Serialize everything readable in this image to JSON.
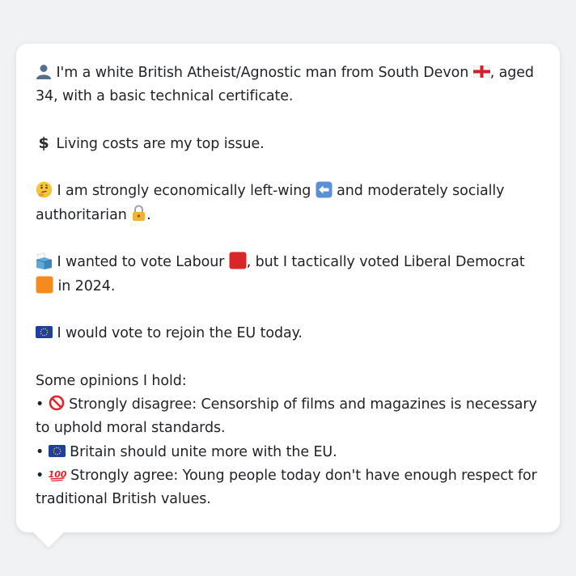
{
  "profile": {
    "intro": {
      "icon": "person-icon",
      "text_a": "I'm a white British Atheist/Agnostic man from South Devon",
      "flag_icon": "england-flag-icon",
      "text_b": ", aged 34, with a basic technical certificate."
    },
    "issue": {
      "icon": "dollar-icon",
      "text": "Living costs are my top issue."
    },
    "ideology": {
      "icon": "thinking-face-icon",
      "text_a": "I am strongly economically left-wing",
      "left_icon": "left-arrow-icon",
      "text_b": "and moderately socially authoritarian",
      "lock_icon": "lock-icon",
      "text_c": "."
    },
    "vote": {
      "icon": "ballot-box-icon",
      "text_a": "I wanted to vote Labour",
      "labour_color": "#d8262a",
      "text_b": ", but I tactically voted Liberal Democrat",
      "libdem_color": "#f58a1f",
      "text_c": "in 2024."
    },
    "eu": {
      "icon": "eu-flag-icon",
      "text": "I would vote to rejoin the EU today."
    },
    "opinions": {
      "heading": "Some opinions I hold:",
      "items": [
        {
          "bullet": "•",
          "icon": "prohibited-icon",
          "text": "Strongly disagree: Censorship of films and magazines is necessary to uphold moral standards."
        },
        {
          "bullet": "•",
          "icon": "eu-flag-icon",
          "text": "Britain should unite more with the EU."
        },
        {
          "bullet": "•",
          "icon": "hundred-points-icon",
          "text": "Strongly agree: Young people today don't have enough respect for traditional British values."
        }
      ]
    }
  }
}
